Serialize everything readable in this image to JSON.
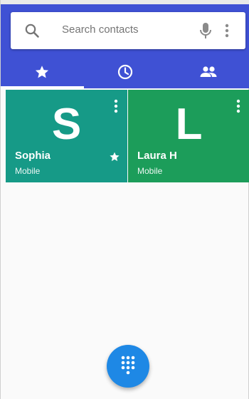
{
  "search": {
    "placeholder": "Search contacts",
    "icons": {
      "left": "search-icon",
      "mic": "mic-icon",
      "more": "more-vert-icon"
    }
  },
  "tabs": [
    {
      "icon": "star-icon",
      "selected": true
    },
    {
      "icon": "clock-icon",
      "selected": false
    },
    {
      "icon": "people-icon",
      "selected": false
    }
  ],
  "favorites": [
    {
      "letter": "S",
      "name": "Sophia",
      "type": "Mobile",
      "starred": true,
      "color": "#169a87"
    },
    {
      "letter": "L",
      "name": "Laura H",
      "type": "Mobile",
      "starred": false,
      "color": "#1c9d5a"
    }
  ],
  "fab": {
    "icon": "dialpad-icon"
  },
  "colors": {
    "appbar": "#3f51d4",
    "fab": "#1e88e5",
    "background": "#fafafa"
  }
}
